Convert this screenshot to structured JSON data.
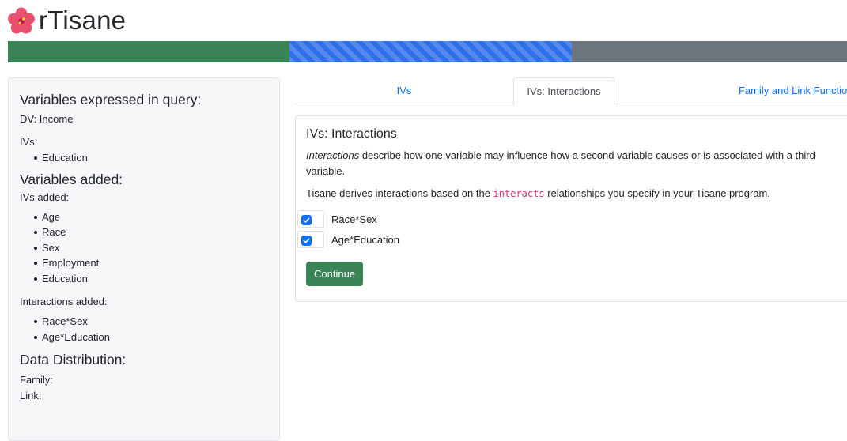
{
  "app": {
    "title": "rTisane",
    "logo_icon": "hibiscus-flower-icon"
  },
  "progress": {
    "completed_steps": 1,
    "current_step": 2,
    "total_steps": 3
  },
  "sidebar": {
    "query_heading": "Variables expressed in query:",
    "dv": "DV: Income",
    "ivs_label": "IVs:",
    "ivs": [
      "Education"
    ],
    "added_heading": "Variables added:",
    "ivs_added_label": "IVs added:",
    "ivs_added": [
      "Age",
      "Race",
      "Sex",
      "Employment",
      "Education"
    ],
    "interactions_added_label": "Interactions added:",
    "interactions_added": [
      "Race*Sex",
      "Age*Education"
    ],
    "distribution_heading": "Data Distribution:",
    "family_label": "Family:",
    "link_label": "Link:"
  },
  "tabs": [
    {
      "label": "IVs",
      "active": false
    },
    {
      "label": "IVs: Interactions",
      "active": true
    },
    {
      "label": "Family and Link Functions",
      "active": false
    }
  ],
  "card": {
    "title": "IVs: Interactions",
    "desc_emph": "Interactions",
    "desc_rest": " describe how one variable may influence how a second variable causes or is associated with a third variable.",
    "derive_pre": "Tisane derives interactions based on the ",
    "derive_code": "interacts",
    "derive_post": " relationships you specify in your Tisane program.",
    "options": [
      {
        "label": "Race*Sex",
        "checked": true
      },
      {
        "label": "Age*Education",
        "checked": true
      }
    ],
    "continue_label": "Continue"
  },
  "colors": {
    "accent_blue": "#0d6efd",
    "success_green": "#3b8457",
    "secondary_gray": "#6c757d"
  }
}
